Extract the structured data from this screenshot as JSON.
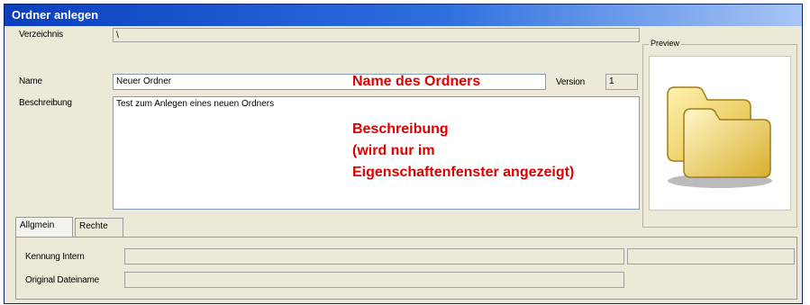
{
  "window": {
    "title": "Ordner anlegen"
  },
  "fields": {
    "verzeichnis": {
      "label": "Verzeichnis",
      "value": "\\"
    },
    "name": {
      "label": "Name",
      "value": "Neuer Ordner"
    },
    "version": {
      "label": "Version",
      "value": "1"
    },
    "beschreibung": {
      "label": "Beschreibung",
      "value": "Test zum Anlegen eines neuen Ordners"
    }
  },
  "annotations": {
    "name": "Name des Ordners",
    "beschreibung_line1": "Beschreibung",
    "beschreibung_line2": "(wird nur im",
    "beschreibung_line3": "Eigenschaftenfenster angezeigt)"
  },
  "preview": {
    "label": "Preview",
    "icon": "folder-icon"
  },
  "tabs": [
    {
      "label": "Allgmein",
      "active": true
    },
    {
      "label": "Rechte",
      "active": false
    }
  ],
  "tab_fields": {
    "kennung_intern": {
      "label": "Kennung Intern",
      "value": "",
      "extra_value": ""
    },
    "original_dateiname": {
      "label": "Original Dateiname",
      "value": ""
    }
  },
  "colors": {
    "title_bar": "#0a3fbf",
    "annotation": "#dd0000",
    "window_bg": "#ece9d8"
  }
}
